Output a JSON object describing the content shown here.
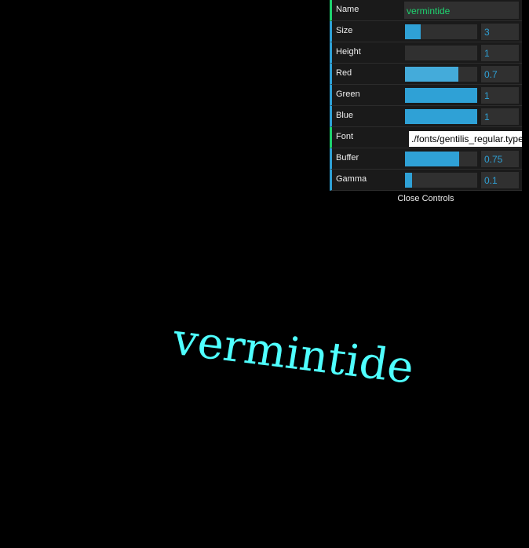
{
  "scene": {
    "text": "vermintide",
    "text_color": "#4fffff"
  },
  "gui": {
    "name": {
      "label": "Name",
      "value": "vermintide"
    },
    "size": {
      "label": "Size",
      "value": "3",
      "fill": 0.22
    },
    "height": {
      "label": "Height",
      "value": "1",
      "fill": 0.0
    },
    "red": {
      "label": "Red",
      "value": "0.7",
      "fill": 0.74
    },
    "green": {
      "label": "Green",
      "value": "1",
      "fill": 1.0
    },
    "blue": {
      "label": "Blue",
      "value": "1",
      "fill": 1.0
    },
    "font": {
      "label": "Font",
      "value": "./fonts/gentilis_regular.typeface.json"
    },
    "buffer": {
      "label": "Buffer",
      "value": "0.75",
      "fill": 0.75
    },
    "gamma": {
      "label": "Gamma",
      "value": "0.1",
      "fill": 0.1
    },
    "close_label": "Close Controls",
    "accent_color": "#2fa1d6",
    "string_color": "#1ed36f"
  }
}
